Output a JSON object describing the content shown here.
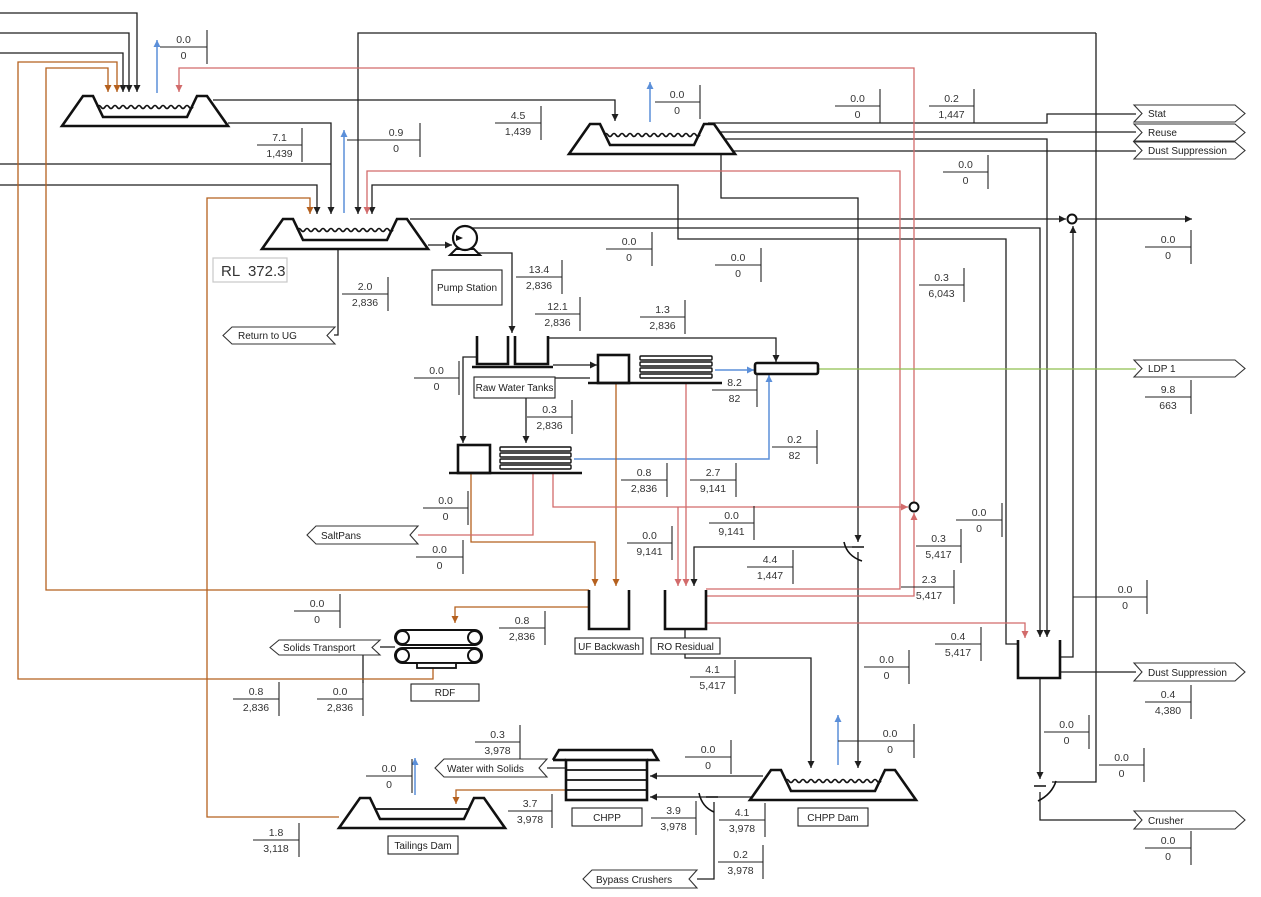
{
  "line_colors": {
    "water": "#1f1f1f",
    "vapour": "#5b8fd9",
    "brine": "#d26b6b",
    "sludge": "#b5601e",
    "treated": "#8fbf4f"
  },
  "elevation_label": "RL  372.3",
  "equipment": {
    "pump_station": "Pump Station",
    "raw_water_tanks": "Raw Water Tanks",
    "uf_backwash": "UF Backwash",
    "ro_residual": "RO Residual",
    "rdf": "RDF",
    "chpp": "CHPP",
    "chpp_dam": "CHPP Dam",
    "tailings_dam": "Tailings Dam"
  },
  "outlets": {
    "stat": "Stat",
    "reuse": "Reuse",
    "dust_suppression_top": "Dust Suppression",
    "ldp1": "LDP 1",
    "dust_suppression_bottom": "Dust Suppression",
    "crusher": "Crusher",
    "return_to_ug": "Return to UG",
    "salt_pans": "SaltPans",
    "solids_transport": "Solids Transport",
    "water_with_solids": "Water with Solids",
    "bypass_crushers": "Bypass Crushers"
  },
  "flow_labels": [
    {
      "upper": "0.0",
      "lower": "0"
    },
    {
      "upper": "7.1",
      "lower": "1,439"
    },
    {
      "upper": "0.9",
      "lower": "0"
    },
    {
      "upper": "4.5",
      "lower": "1,439"
    },
    {
      "upper": "0.0",
      "lower": "0"
    },
    {
      "upper": "0.0",
      "lower": "0"
    },
    {
      "upper": "0.2",
      "lower": "1,447"
    },
    {
      "upper": "0.0",
      "lower": "0"
    },
    {
      "upper": "0.0",
      "lower": "0"
    },
    {
      "upper": "0.0",
      "lower": "0"
    },
    {
      "upper": "0.3",
      "lower": "6,043"
    },
    {
      "upper": "0.0",
      "lower": "0"
    },
    {
      "upper": "2.0",
      "lower": "2,836"
    },
    {
      "upper": "13.4",
      "lower": "2,836"
    },
    {
      "upper": "12.1",
      "lower": "2,836"
    },
    {
      "upper": "1.3",
      "lower": "2,836"
    },
    {
      "upper": "0.0",
      "lower": "0"
    },
    {
      "upper": "8.2",
      "lower": "82"
    },
    {
      "upper": "0.3",
      "lower": "2,836"
    },
    {
      "upper": "0.2",
      "lower": "82"
    },
    {
      "upper": "0.8",
      "lower": "2,836"
    },
    {
      "upper": "2.7",
      "lower": "9,141"
    },
    {
      "upper": "0.0",
      "lower": "0"
    },
    {
      "upper": "0.0",
      "lower": "9,141"
    },
    {
      "upper": "0.0",
      "lower": "9,141"
    },
    {
      "upper": "0.0",
      "lower": "0"
    },
    {
      "upper": "4.4",
      "lower": "1,447"
    },
    {
      "upper": "0.3",
      "lower": "5,417"
    },
    {
      "upper": "0.0",
      "lower": "0"
    },
    {
      "upper": "2.3",
      "lower": "5,417"
    },
    {
      "upper": "0.0",
      "lower": "0"
    },
    {
      "upper": "0.8",
      "lower": "2,836"
    },
    {
      "upper": "0.4",
      "lower": "5,417"
    },
    {
      "upper": "4.1",
      "lower": "5,417"
    },
    {
      "upper": "0.0",
      "lower": "0"
    },
    {
      "upper": "0.8",
      "lower": "2,836"
    },
    {
      "upper": "0.0",
      "lower": "2,836"
    },
    {
      "upper": "0.3",
      "lower": "3,978"
    },
    {
      "upper": "0.0",
      "lower": "0"
    },
    {
      "upper": "0.0",
      "lower": "0"
    },
    {
      "upper": "0.0",
      "lower": "0"
    },
    {
      "upper": "3.7",
      "lower": "3,978"
    },
    {
      "upper": "1.8",
      "lower": "3,118"
    },
    {
      "upper": "3.9",
      "lower": "3,978"
    },
    {
      "upper": "4.1",
      "lower": "3,978"
    },
    {
      "upper": "0.2",
      "lower": "3,978"
    },
    {
      "upper": "9.8",
      "lower": "663"
    },
    {
      "upper": "0.0",
      "lower": "0"
    },
    {
      "upper": "0.4",
      "lower": "4,380"
    },
    {
      "upper": "0.0",
      "lower": "0"
    },
    {
      "upper": "0.0",
      "lower": "0"
    },
    {
      "upper": "0.0",
      "lower": "0"
    }
  ]
}
